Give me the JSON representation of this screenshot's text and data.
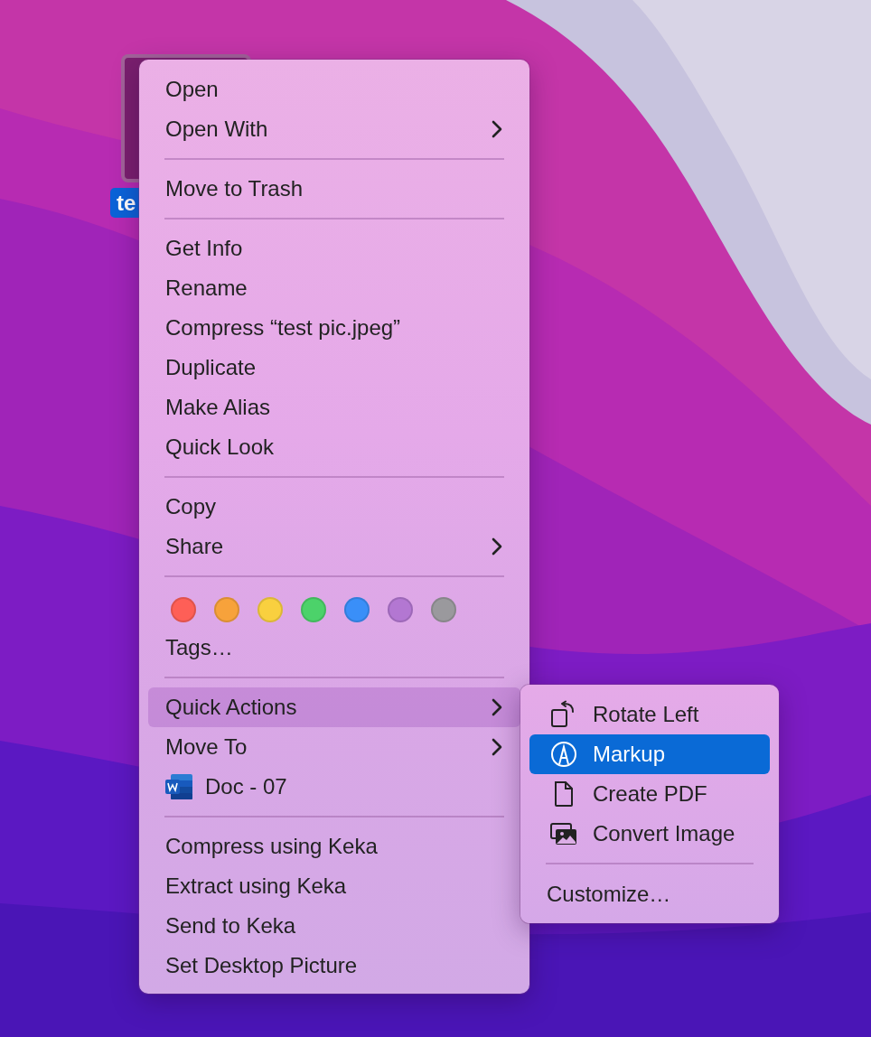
{
  "desktop_file": {
    "label": "te",
    "selected": true
  },
  "context_menu": {
    "items": [
      {
        "kind": "item",
        "label": "Open",
        "submenu": false,
        "selected": false
      },
      {
        "kind": "item",
        "label": "Open With",
        "submenu": true,
        "selected": false
      },
      {
        "kind": "separator"
      },
      {
        "kind": "item",
        "label": "Move to Trash",
        "submenu": false,
        "selected": false
      },
      {
        "kind": "separator"
      },
      {
        "kind": "item",
        "label": "Get Info",
        "submenu": false,
        "selected": false
      },
      {
        "kind": "item",
        "label": "Rename",
        "submenu": false,
        "selected": false
      },
      {
        "kind": "item",
        "label": "Compress “test pic.jpeg”",
        "submenu": false,
        "selected": false
      },
      {
        "kind": "item",
        "label": "Duplicate",
        "submenu": false,
        "selected": false
      },
      {
        "kind": "item",
        "label": "Make Alias",
        "submenu": false,
        "selected": false
      },
      {
        "kind": "item",
        "label": "Quick Look",
        "submenu": false,
        "selected": false
      },
      {
        "kind": "separator"
      },
      {
        "kind": "item",
        "label": "Copy",
        "submenu": false,
        "selected": false
      },
      {
        "kind": "item",
        "label": "Share",
        "submenu": true,
        "selected": false
      },
      {
        "kind": "separator"
      },
      {
        "kind": "tags",
        "tags": [
          {
            "color": "#fe5f57"
          },
          {
            "color": "#f7a23b"
          },
          {
            "color": "#f9d03f"
          },
          {
            "color": "#4cd26a"
          },
          {
            "color": "#3a8ff8"
          },
          {
            "color": "#b377d2"
          },
          {
            "color": "#9a999d"
          }
        ]
      },
      {
        "kind": "item",
        "label": "Tags…",
        "submenu": false,
        "selected": false
      },
      {
        "kind": "separator"
      },
      {
        "kind": "item",
        "label": "Quick Actions",
        "submenu": true,
        "selected": true
      },
      {
        "kind": "item",
        "label": "Move To",
        "submenu": true,
        "selected": false
      },
      {
        "kind": "app-item",
        "label": "Doc - 07",
        "submenu": false,
        "selected": false
      },
      {
        "kind": "separator"
      },
      {
        "kind": "item",
        "label": "Compress using Keka",
        "submenu": false,
        "selected": false
      },
      {
        "kind": "item",
        "label": "Extract using Keka",
        "submenu": false,
        "selected": false
      },
      {
        "kind": "item",
        "label": "Send to Keka",
        "submenu": false,
        "selected": false
      },
      {
        "kind": "item",
        "label": "Set Desktop Picture",
        "submenu": false,
        "selected": false
      }
    ]
  },
  "quick_actions_menu": {
    "items": [
      {
        "kind": "rotate",
        "label": "Rotate Left",
        "selected": false
      },
      {
        "kind": "markup",
        "label": "Markup",
        "selected": true
      },
      {
        "kind": "pdf",
        "label": "Create PDF",
        "selected": false
      },
      {
        "label": "Convert Image",
        "selected": false
      },
      {
        "kind": "separator"
      },
      {
        "kind": "plain",
        "label": "Customize…",
        "selected": false
      }
    ]
  }
}
